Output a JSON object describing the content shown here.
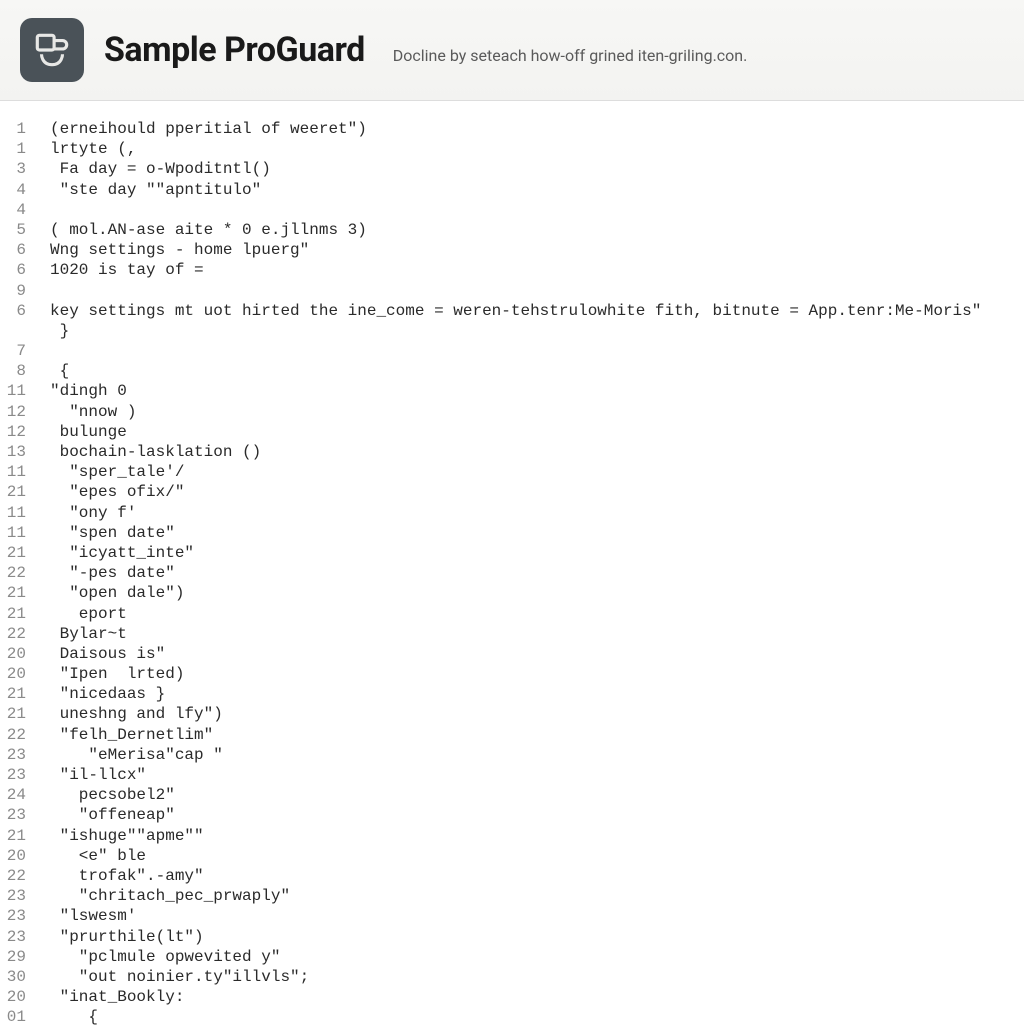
{
  "header": {
    "title": "Sample ProGuard",
    "subtitle": "Docline by seteach how-off grined iten-griling.con."
  },
  "lines": [
    {
      "n": "1",
      "t": "(erneihould pperitial of weeret\")"
    },
    {
      "n": "1",
      "t": "lrtyte (,"
    },
    {
      "n": "3",
      "t": " Fa day = o-Wpoditntl()"
    },
    {
      "n": "4",
      "t": " \"ste day \"\"apntitulo\""
    },
    {
      "n": "4",
      "t": ""
    },
    {
      "n": "5",
      "t": "( mol.AN-ase aite * 0 e.jllnms 3)"
    },
    {
      "n": "6",
      "t": "Wng settings - home lpuerg\""
    },
    {
      "n": "6",
      "t": "1020 is tay of ="
    },
    {
      "n": "9",
      "t": ""
    },
    {
      "n": "6",
      "t": "key settings mt uot hirted the ine_come = weren-tehstrulowhite fith, bitnute = App.tenr:Me-Moris\""
    },
    {
      "n": "",
      "t": " }"
    },
    {
      "n": "7",
      "t": ""
    },
    {
      "n": "8",
      "t": " {"
    },
    {
      "n": "11",
      "t": "\"dingh 0"
    },
    {
      "n": "12",
      "t": "  \"nnow )"
    },
    {
      "n": "12",
      "t": " bulunge"
    },
    {
      "n": "13",
      "t": " bochain-lasklation ()"
    },
    {
      "n": "11",
      "t": "  \"sper_tale'/"
    },
    {
      "n": "21",
      "t": "  \"epes ofix/\""
    },
    {
      "n": "11",
      "t": "  \"ony f'"
    },
    {
      "n": "11",
      "t": "  \"spen date\""
    },
    {
      "n": "21",
      "t": "  \"icyatt_inte\""
    },
    {
      "n": "22",
      "t": "  \"-pes date\""
    },
    {
      "n": "21",
      "t": "  \"open dale\")"
    },
    {
      "n": "21",
      "t": "   eport"
    },
    {
      "n": "22",
      "t": " Bylar~t"
    },
    {
      "n": "20",
      "t": " Daisous is\""
    },
    {
      "n": "20",
      "t": " \"Ipen  lrted)"
    },
    {
      "n": "21",
      "t": " \"nicedaas }"
    },
    {
      "n": "21",
      "t": " uneshng and lfy\")"
    },
    {
      "n": "22",
      "t": " \"felh_Dernetlim\""
    },
    {
      "n": "23",
      "t": "    \"eMerisa\"cap \""
    },
    {
      "n": "23",
      "t": " \"il-llcx\""
    },
    {
      "n": "24",
      "t": "   pecsobel2\""
    },
    {
      "n": "23",
      "t": "   \"offeneap\""
    },
    {
      "n": "21",
      "t": " \"ishuge\"\"apme\"\""
    },
    {
      "n": "20",
      "t": "   <e\" ble"
    },
    {
      "n": "22",
      "t": "   trofak\".-amy\""
    },
    {
      "n": "23",
      "t": "   \"chritach_pec_prwaply\""
    },
    {
      "n": "23",
      "t": " \"lswesm'"
    },
    {
      "n": "23",
      "t": " \"prurthile(lt\")"
    },
    {
      "n": "29",
      "t": "   \"pclmule opwevited y\""
    },
    {
      "n": "30",
      "t": "   \"out noinier.ty\"illvls\";"
    },
    {
      "n": "20",
      "t": " \"inat_Bookly:"
    },
    {
      "n": "01",
      "t": "    {"
    }
  ]
}
